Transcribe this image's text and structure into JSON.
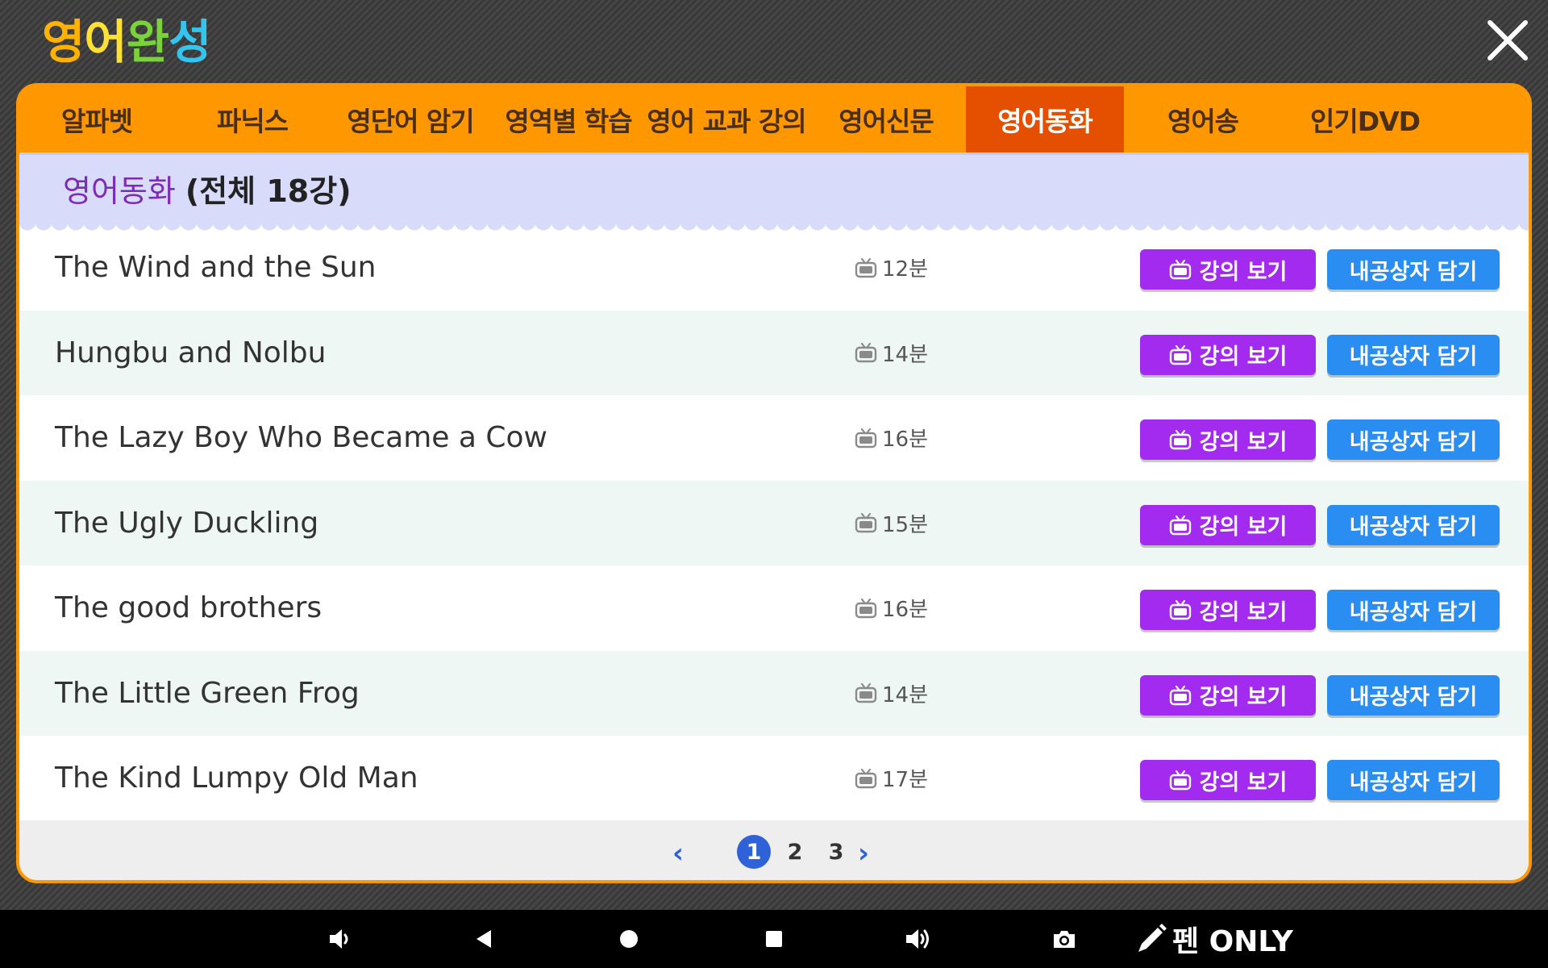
{
  "app": {
    "logo_chars": [
      {
        "char": "영",
        "color": "#ffb300"
      },
      {
        "char": "어",
        "color": "#ffe033"
      },
      {
        "char": "완",
        "color": "#7bd33b"
      },
      {
        "char": "성",
        "color": "#35c4ee"
      }
    ]
  },
  "nav": {
    "tabs": [
      {
        "label": "알파벳"
      },
      {
        "label": "파닉스"
      },
      {
        "label": "영단어 암기"
      },
      {
        "label": "영역별 학습"
      },
      {
        "label": "영어 교과 강의"
      },
      {
        "label": "영어신문"
      },
      {
        "label": "영어동화",
        "active": true
      },
      {
        "label": "영어송"
      },
      {
        "label": "인기DVD"
      }
    ]
  },
  "section": {
    "name": "영어동화",
    "count": "(전체 18강)"
  },
  "buttons": {
    "watch_label": "강의 보기",
    "save_label": "내공상자 담기"
  },
  "lessons": [
    {
      "title": "The Wind and the Sun",
      "duration": "12분"
    },
    {
      "title": "Hungbu and Nolbu",
      "duration": "14분"
    },
    {
      "title": "The Lazy Boy Who Became a Cow",
      "duration": "16분"
    },
    {
      "title": "The Ugly Duckling",
      "duration": "15분"
    },
    {
      "title": "The good brothers",
      "duration": "16분"
    },
    {
      "title": "The Little Green Frog",
      "duration": "14분"
    },
    {
      "title": "The Kind Lumpy Old Man",
      "duration": "17분"
    }
  ],
  "pagination": {
    "prev": "‹",
    "next": "›",
    "pages": [
      "1",
      "2",
      "3"
    ],
    "current": "1"
  },
  "system_bar": {
    "pen_label": "펜 ONLY",
    "icons": [
      "volume-down-icon",
      "back-icon",
      "home-icon",
      "recents-icon",
      "volume-up-icon",
      "camera-icon"
    ]
  },
  "colors": {
    "tab_bar": "#ff9800",
    "tab_active": "#e45000",
    "watch_button": "#a32bf0",
    "save_button": "#2a8df2",
    "page_active": "#2f62d8",
    "header_band": "#d9dbfa"
  }
}
